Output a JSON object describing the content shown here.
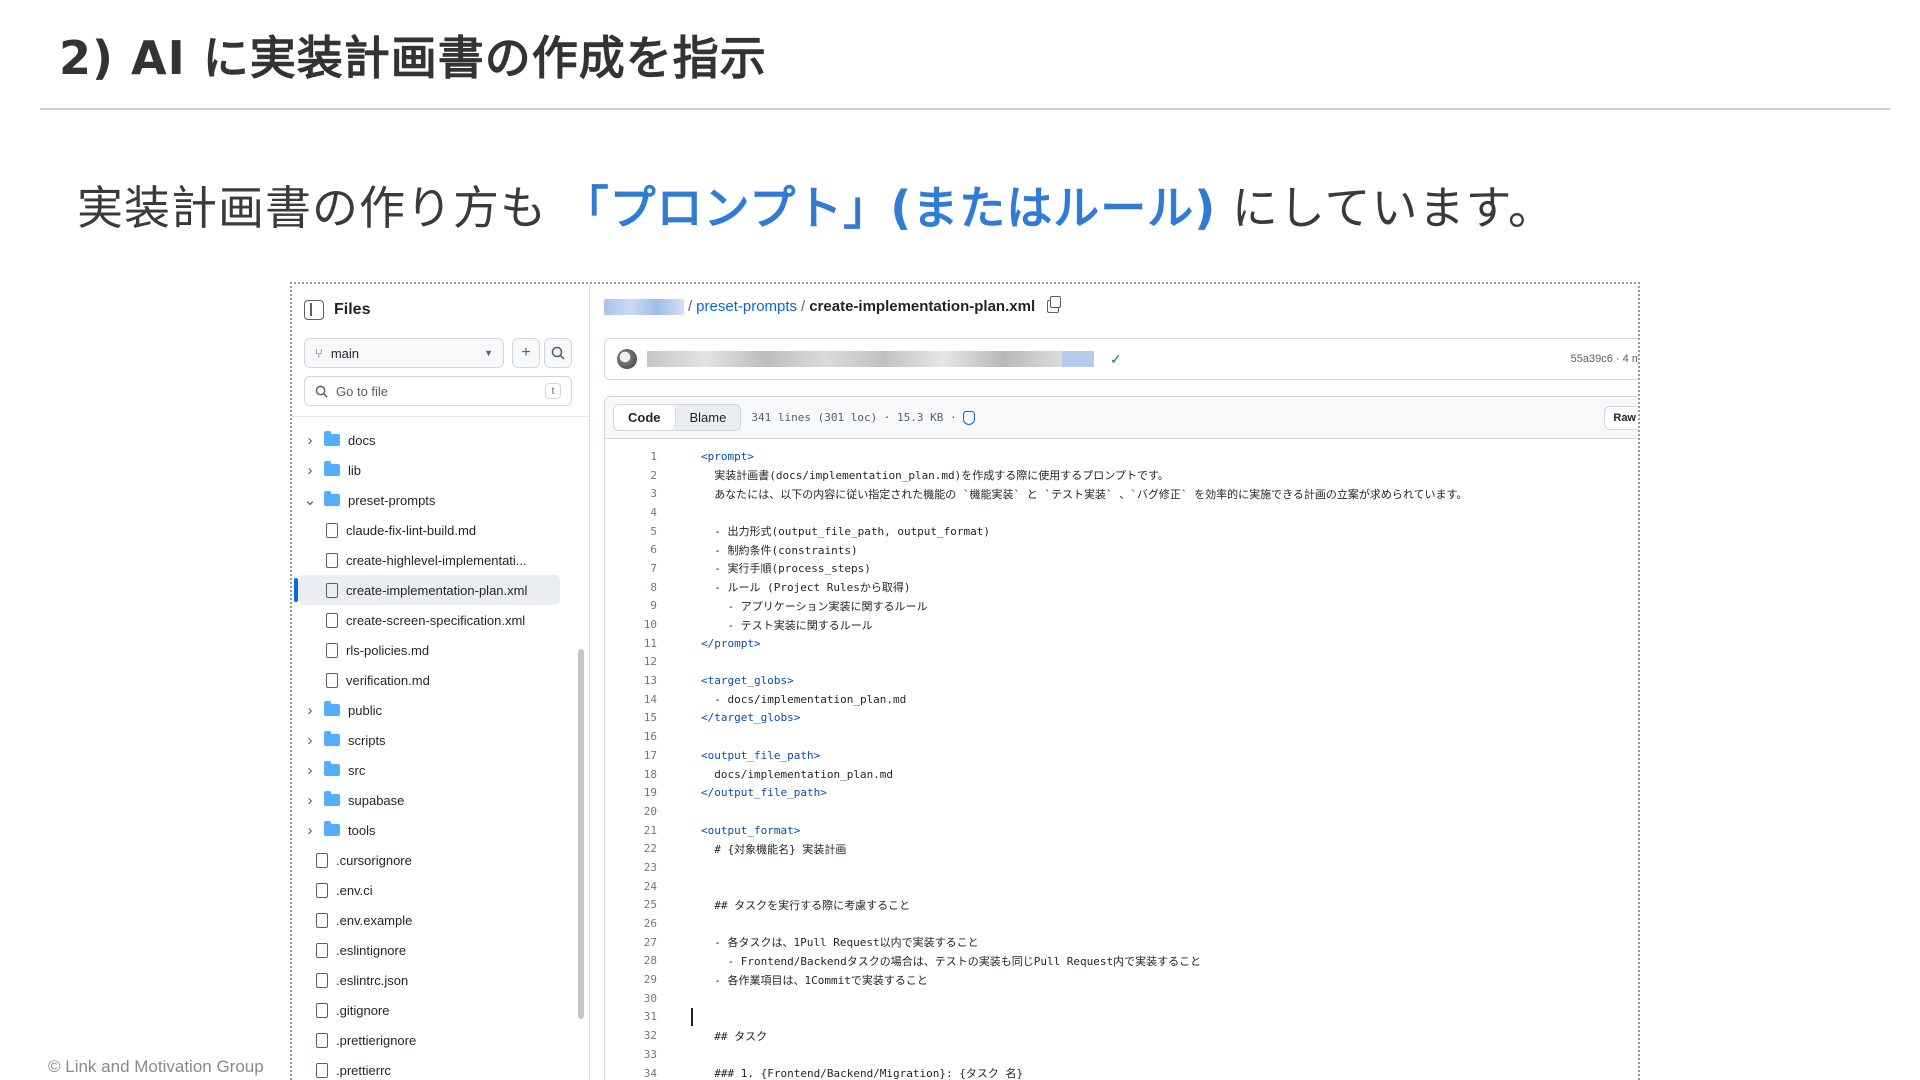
{
  "slide": {
    "title": "2) AI に実装計画書の作成を指示",
    "subtitle_pre": "実装計画書の作り方も ",
    "subtitle_highlight": "「プロンプト」(またはルール)",
    "subtitle_post": " にしています。",
    "footer": "© Link and Motivation Group",
    "highlight_color": "#2f7bd6"
  },
  "filepane": {
    "title": "Files",
    "branch": "main",
    "goto_placeholder": "Go to file",
    "goto_key": "t",
    "items": [
      {
        "type": "folder",
        "state": "collapsed",
        "depth": 0,
        "name": "docs"
      },
      {
        "type": "folder",
        "state": "collapsed",
        "depth": 0,
        "name": "lib"
      },
      {
        "type": "folder",
        "state": "expanded",
        "depth": 0,
        "name": "preset-prompts"
      },
      {
        "type": "file",
        "depth": 1,
        "name": "claude-fix-lint-build.md"
      },
      {
        "type": "file",
        "depth": 1,
        "name": "create-highlevel-implementati..."
      },
      {
        "type": "file",
        "depth": 1,
        "name": "create-implementation-plan.xml",
        "selected": true
      },
      {
        "type": "file",
        "depth": 1,
        "name": "create-screen-specification.xml"
      },
      {
        "type": "file",
        "depth": 1,
        "name": "rls-policies.md"
      },
      {
        "type": "file",
        "depth": 1,
        "name": "verification.md"
      },
      {
        "type": "folder",
        "state": "collapsed",
        "depth": 0,
        "name": "public"
      },
      {
        "type": "folder",
        "state": "collapsed",
        "depth": 0,
        "name": "scripts"
      },
      {
        "type": "folder",
        "state": "collapsed",
        "depth": 0,
        "name": "src"
      },
      {
        "type": "folder",
        "state": "collapsed",
        "depth": 0,
        "name": "supabase"
      },
      {
        "type": "folder",
        "state": "collapsed",
        "depth": 0,
        "name": "tools"
      },
      {
        "type": "file",
        "depth": 0,
        "name": ".cursorignore"
      },
      {
        "type": "file",
        "depth": 0,
        "name": ".env.ci"
      },
      {
        "type": "file",
        "depth": 0,
        "name": ".env.example"
      },
      {
        "type": "file",
        "depth": 0,
        "name": ".eslintignore"
      },
      {
        "type": "file",
        "depth": 0,
        "name": ".eslintrc.json"
      },
      {
        "type": "file",
        "depth": 0,
        "name": ".gitignore"
      },
      {
        "type": "file",
        "depth": 0,
        "name": ".prettierignore"
      },
      {
        "type": "file",
        "depth": 0,
        "name": ".prettierrc"
      }
    ]
  },
  "breadcrumb": {
    "folder": "preset-prompts",
    "separator": "/",
    "file": "create-implementation-plan.xml"
  },
  "commit": {
    "sha": "55a39c6 · 4 m"
  },
  "code": {
    "tab_code": "Code",
    "tab_blame": "Blame",
    "meta": "341 lines (301 loc) · 15.3 KB ·",
    "raw": "Raw",
    "lines": [
      {
        "n": "1",
        "t": "<prompt>"
      },
      {
        "n": "2",
        "t": "  実装計画書(docs/implementation_plan.md)を作成する際に使用するプロンプトです。"
      },
      {
        "n": "3",
        "t": "  あなたには、以下の内容に従い指定された機能の `機能実装` と `テスト実装` 、`バグ修正` を効率的に実施できる計画の立案が求められています。"
      },
      {
        "n": "4",
        "t": ""
      },
      {
        "n": "5",
        "t": "  - 出力形式(output_file_path, output_format)"
      },
      {
        "n": "6",
        "t": "  - 制約条件(constraints)"
      },
      {
        "n": "7",
        "t": "  - 実行手順(process_steps)"
      },
      {
        "n": "8",
        "t": "  - ルール (Project Rulesから取得)"
      },
      {
        "n": "9",
        "t": "    - アプリケーション実装に関するルール"
      },
      {
        "n": "10",
        "t": "    - テスト実装に関するルール"
      },
      {
        "n": "11",
        "t": "</prompt>"
      },
      {
        "n": "12",
        "t": ""
      },
      {
        "n": "13",
        "t": "<target_globs>"
      },
      {
        "n": "14",
        "t": "  - docs/implementation_plan.md"
      },
      {
        "n": "15",
        "t": "</target_globs>"
      },
      {
        "n": "16",
        "t": ""
      },
      {
        "n": "17",
        "t": "<output_file_path>"
      },
      {
        "n": "18",
        "t": "  docs/implementation_plan.md"
      },
      {
        "n": "19",
        "t": "</output_file_path>"
      },
      {
        "n": "20",
        "t": ""
      },
      {
        "n": "21",
        "t": "<output_format>"
      },
      {
        "n": "22",
        "t": "  # {対象機能名} 実装計画"
      },
      {
        "n": "23",
        "t": ""
      },
      {
        "n": "24",
        "t": ""
      },
      {
        "n": "25",
        "t": "  ## タスクを実行する際に考慮すること"
      },
      {
        "n": "26",
        "t": ""
      },
      {
        "n": "27",
        "t": "  - 各タスクは、1Pull Request以内で実装すること"
      },
      {
        "n": "28",
        "t": "    - Frontend/Backendタスクの場合は、テストの実装も同じPull Request内で実装すること"
      },
      {
        "n": "29",
        "t": "  - 各作業項目は、1Commitで実装すること"
      },
      {
        "n": "30",
        "t": ""
      },
      {
        "n": "31",
        "t": ""
      },
      {
        "n": "32",
        "t": "  ## タスク"
      },
      {
        "n": "33",
        "t": ""
      },
      {
        "n": "34",
        "t": "  ### 1. {Frontend/Backend/Migration}: {タスク 名}"
      }
    ]
  }
}
